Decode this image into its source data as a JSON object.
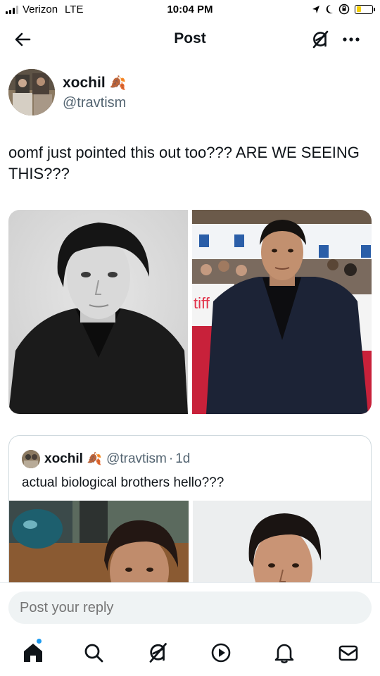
{
  "status_bar": {
    "carrier": "Verizon",
    "network": "LTE",
    "time": "10:04 PM",
    "battery_level": 0.3,
    "battery_color": "#f5cf00"
  },
  "header": {
    "title": "Post",
    "back_icon": "arrow-left-icon",
    "grok_icon": "grok-icon",
    "more_icon": "more-dots-icon"
  },
  "tweet": {
    "author_name": "xochil",
    "author_emoji": "🍂",
    "author_handle": "@travtism",
    "text": "oomf just pointed this out too??? ARE WE SEEING THIS???"
  },
  "quoted_tweet": {
    "author_name": "xochil",
    "author_emoji": "🍂",
    "author_handle": "@travtism",
    "separator": "·",
    "time_ago": "1d",
    "text": "actual biological brothers hello???"
  },
  "reply": {
    "placeholder": "Post your reply"
  },
  "bottom_nav": {
    "items": [
      "home-icon",
      "search-icon",
      "grok-icon",
      "play-icon",
      "bell-icon",
      "mail-icon"
    ],
    "accent_color": "#1d9bf0"
  }
}
